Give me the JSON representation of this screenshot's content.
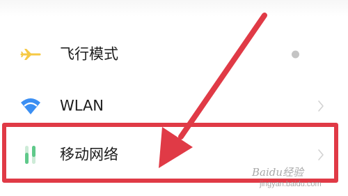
{
  "settings": {
    "items": [
      {
        "label": "飞行模式",
        "icon": "airplane-icon",
        "control": "toggle-dot"
      },
      {
        "label": "WLAN",
        "icon": "wifi-icon",
        "control": "chevron-right-icon"
      },
      {
        "label": "移动网络",
        "icon": "mobile-data-icon",
        "control": "chevron-right-icon"
      }
    ]
  },
  "annotation": {
    "highlighted_item": "移动网络",
    "color": "#e03a46"
  },
  "watermark": {
    "logo": "Baidu经验",
    "url": "jingyan.baidu.com"
  },
  "colors": {
    "airplane": "#f6c945",
    "wifi": "#3b8ff3",
    "mobile_data": "#5fc98a",
    "annotation_red": "#e03a46"
  }
}
